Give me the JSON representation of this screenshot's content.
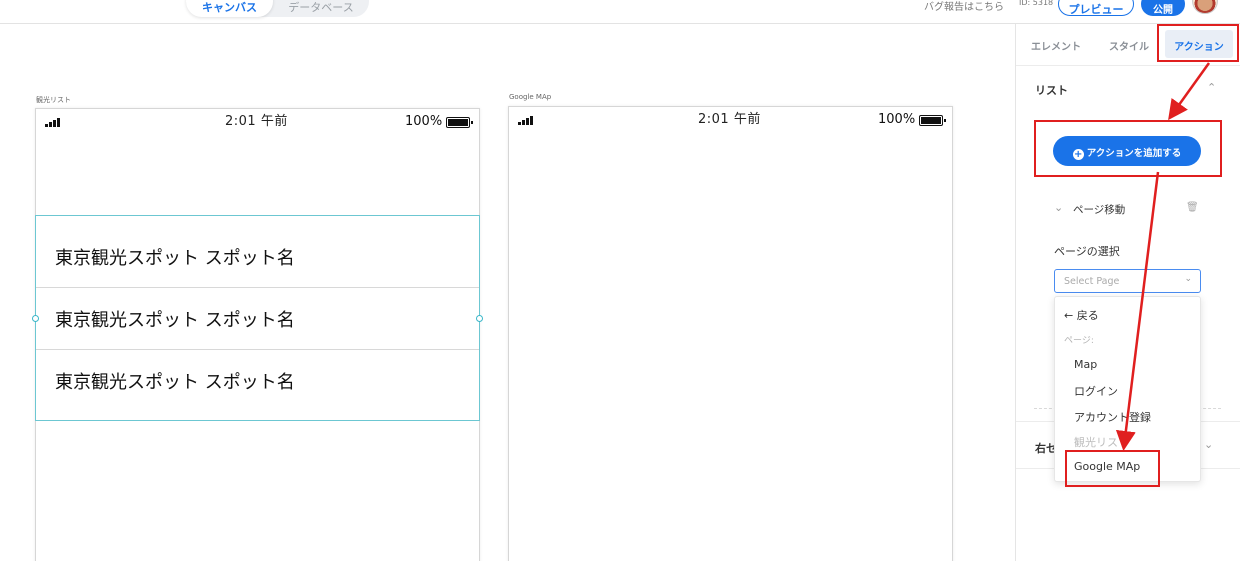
{
  "header": {
    "tabs": [
      {
        "label": "キャンバス",
        "active": true
      },
      {
        "label": "データベース",
        "active": false
      }
    ],
    "bug_report_link": "バグ報告はこちら",
    "project_id": "ID: 5318",
    "preview_button": "プレビュー",
    "publish_button": "公開",
    "accent_color": "#1a73e8"
  },
  "canvas": {
    "frames": [
      {
        "label": "観光リスト",
        "status": {
          "time": "2:01 午前",
          "battery": "100%"
        },
        "list_items": [
          "東京観光スポット スポット名",
          "東京観光スポット スポット名",
          "東京観光スポット スポット名"
        ]
      },
      {
        "label": "Google MAp",
        "status": {
          "time": "2:01 午前",
          "battery": "100%"
        }
      }
    ]
  },
  "panel": {
    "tabs": [
      "エレメント",
      "スタイル",
      "アクション"
    ],
    "active_tab": "アクション",
    "section_title": "リスト",
    "add_action_button": "アクションを追加する",
    "action": {
      "name": "ページ移動",
      "field_label": "ページの選択",
      "select_placeholder": "Select Page"
    },
    "dropdown": {
      "back": "← 戻る",
      "group_label": "ページ:",
      "items": [
        "Map",
        "ログイン",
        "アカウント登録",
        "観光リスト",
        "Google MAp"
      ],
      "disabled_item": "観光リスト",
      "highlighted_item": "Google MAp"
    },
    "second_section_title": "右セ"
  },
  "annotation_color": "#e01f1f"
}
